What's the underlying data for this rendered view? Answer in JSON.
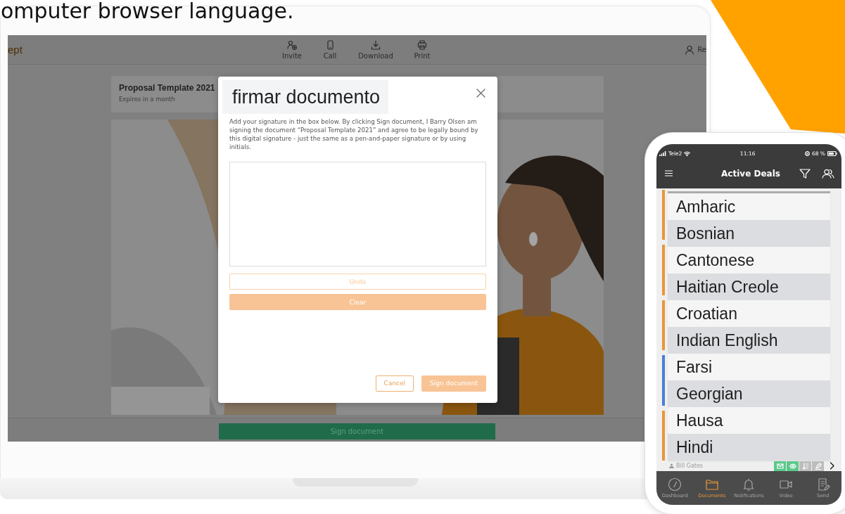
{
  "headline": "omputer browser language.",
  "app": {
    "logo": "ept",
    "toolbar": [
      {
        "label": "Invite",
        "kind": "invite"
      },
      {
        "label": "Call",
        "kind": "call"
      },
      {
        "label": "Download",
        "kind": "download"
      },
      {
        "label": "Print",
        "kind": "print"
      }
    ],
    "account": "Re",
    "document": {
      "title": "Proposal Template 2021",
      "subtitle": "Expires in a month"
    },
    "footer_button": "Sign document"
  },
  "dialog": {
    "title": "firmar documento",
    "message": "Add your signature in the box below. By clicking Sign document, I Barry Olsen am signing the document “Proposal Template 2021” and agree to be legally bound by this digital signature - just the same as a pen-and-paper signature or by using initials.",
    "undo": "Undo",
    "clear": "Clear",
    "cancel": "Cancel",
    "confirm": "Sign document"
  },
  "phone": {
    "status": {
      "carrier": "Tele2",
      "time": "11:16",
      "battery": "68 %"
    },
    "title": "Active Deals",
    "deal_cards": [
      {
        "color": "#e8963a"
      },
      {
        "color": "#e8963a"
      },
      {
        "color": "#e8963a"
      },
      {
        "color": "#4a7fd4"
      },
      {
        "color": "#e8963a"
      }
    ],
    "languages": [
      "Amharic",
      "Bosnian",
      "Cantonese",
      "Haitian Creole",
      "Croatian",
      "Indian English",
      "Farsi",
      "Georgian",
      "Hausa",
      "Hindi"
    ],
    "contact": "Bill Gates",
    "actions": [
      {
        "kind": "mail",
        "done": true
      },
      {
        "kind": "eye",
        "done": true
      },
      {
        "kind": "sort",
        "done": false
      },
      {
        "kind": "pen",
        "done": false
      }
    ],
    "tabs": [
      {
        "label": "Dashboard",
        "kind": "compass",
        "selected": false
      },
      {
        "label": "Documents",
        "kind": "folder",
        "selected": true
      },
      {
        "label": "Notifications",
        "kind": "bell",
        "selected": false
      },
      {
        "label": "Video",
        "kind": "video",
        "selected": false
      },
      {
        "label": "Send",
        "kind": "document",
        "selected": false
      }
    ]
  }
}
